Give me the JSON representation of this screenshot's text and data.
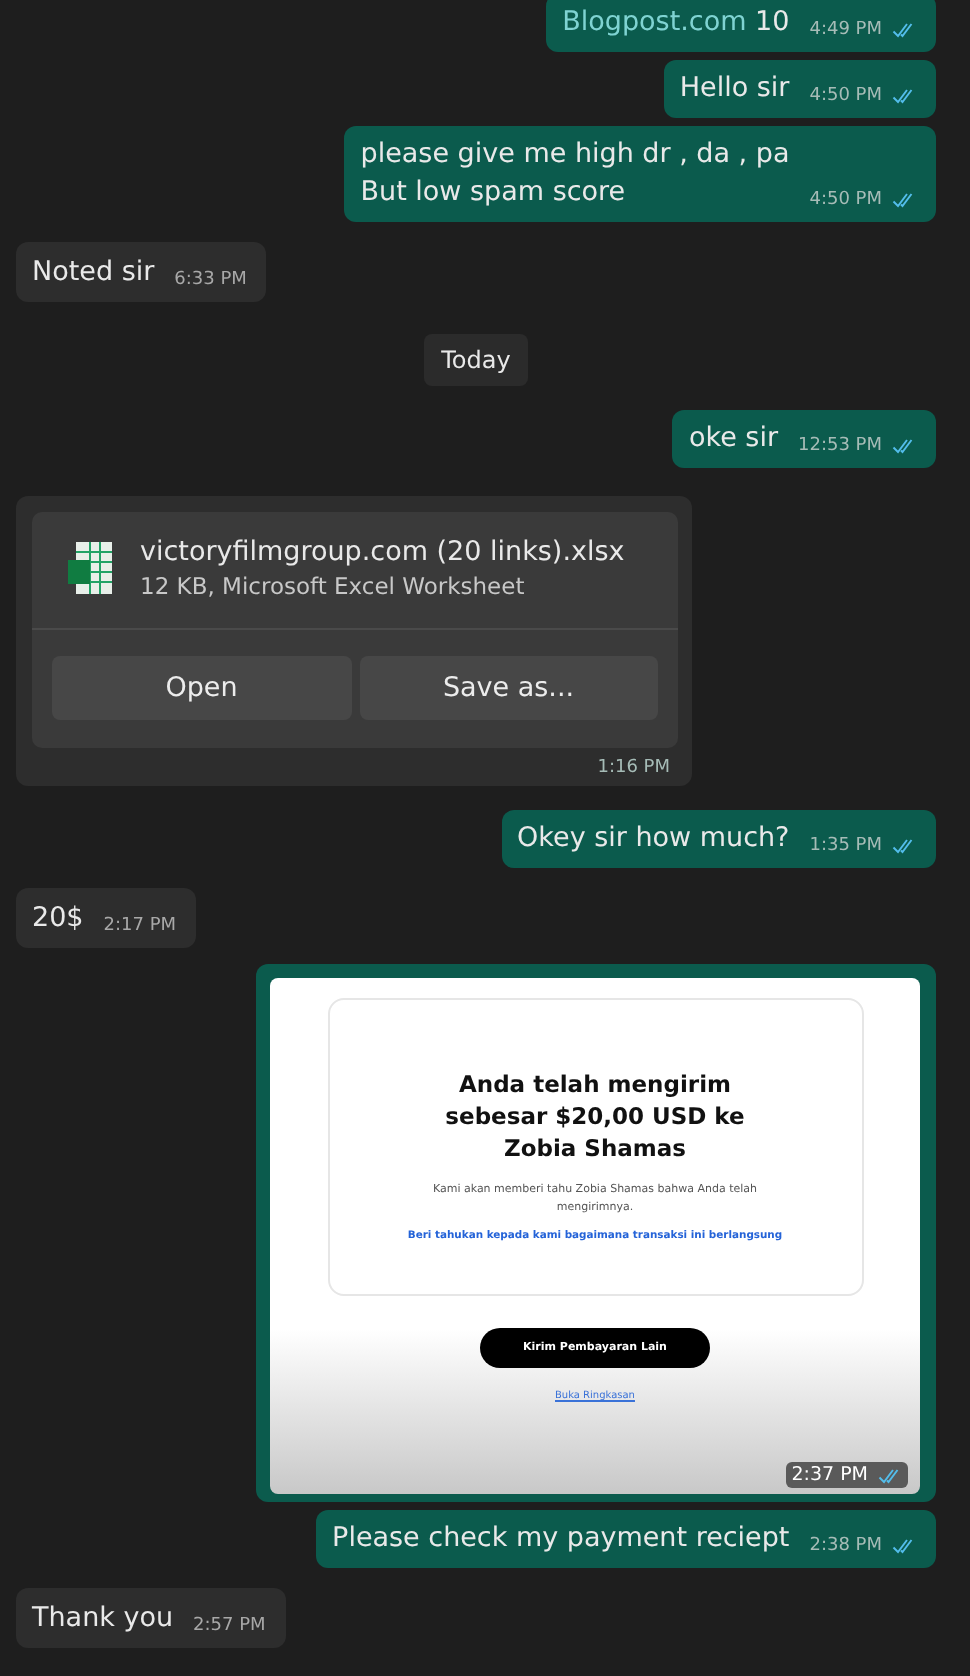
{
  "messages": [
    {
      "kind": "out",
      "link": "Blogpost.com",
      "text": " 10",
      "time": "4:49 PM",
      "read": true
    },
    {
      "kind": "out",
      "text": "Hello sir",
      "time": "4:50 PM",
      "read": true
    },
    {
      "kind": "out",
      "lines": [
        "please give me high dr , da , pa",
        "But low spam score"
      ],
      "time": "4:50 PM",
      "read": true
    },
    {
      "kind": "in",
      "text": "Noted sir",
      "time": "6:33 PM"
    },
    {
      "kind": "date",
      "text": "Today"
    },
    {
      "kind": "out",
      "text": "oke sir",
      "time": "12:53 PM",
      "read": true
    },
    {
      "kind": "file",
      "name": "victoryfilmgroup.com (20 links).xlsx",
      "meta": "12 KB, Microsoft Excel Worksheet",
      "buttons": [
        "Open",
        "Save as..."
      ],
      "time": "1:16 PM"
    },
    {
      "kind": "out",
      "text": "Okey sir how much?",
      "time": "1:35 PM",
      "read": true
    },
    {
      "kind": "in",
      "text": "20$",
      "time": "2:17 PM"
    },
    {
      "kind": "image",
      "doc": {
        "title": "Anda telah mengirim sebesar $20,00 USD ke Zobia Shamas",
        "body": "Kami akan memberi tahu Zobia Shamas bahwa Anda telah mengirimnya.",
        "feedback": "Beri tahukan kepada kami bagaimana transaksi ini berlangsung",
        "button": "Kirim Pembayaran Lain",
        "link": "Buka Ringkasan"
      },
      "time": "2:37 PM",
      "read": true
    },
    {
      "kind": "out",
      "text": "Please check my payment reciept",
      "time": "2:38 PM",
      "read": true
    },
    {
      "kind": "in",
      "text": "Thank you",
      "time": "2:57 PM"
    }
  ]
}
